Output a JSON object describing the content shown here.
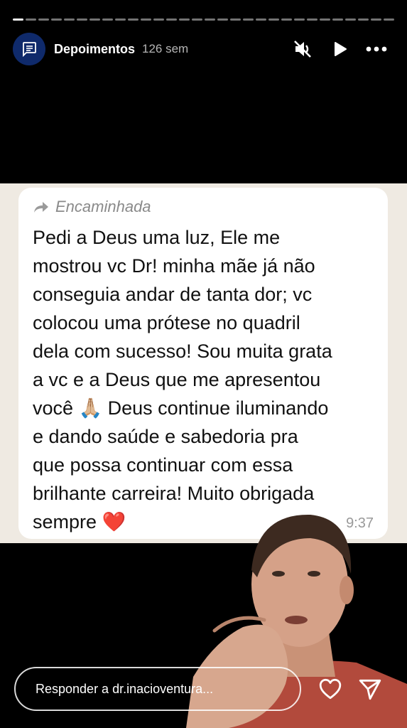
{
  "story": {
    "segments": 30,
    "active_index": 0
  },
  "header": {
    "account_name": "Depoimentos",
    "time_ago": "126 sem",
    "avatar_icon": "chat-bubble-icon",
    "actions": [
      "mute-icon",
      "play-icon",
      "more-icon"
    ]
  },
  "message": {
    "forwarded_label": "Encaminhada",
    "text": "Pedi a Deus uma luz, Ele me\nmostrou vc Dr! minha mãe já não\nconseguia andar de tanta dor; vc\ncolocou uma  prótese no quadril\ndela com sucesso! Sou muita grata\na vc e a Deus que me  apresentou\nvocê 🙏🏼 Deus continue iluminando\ne dando saúde e sabedoria pra\nque possa continuar com essa\nbrilhante carreira! Muito obrigada\nsempre ❤️",
    "time": "9:37"
  },
  "footer": {
    "reply_placeholder": "Responder a dr.inacioventura...",
    "like_icon": "heart-icon",
    "share_icon": "send-icon"
  },
  "colors": {
    "chat_bg": "#efeae2",
    "avatar_bg": "#0f2a6b"
  }
}
